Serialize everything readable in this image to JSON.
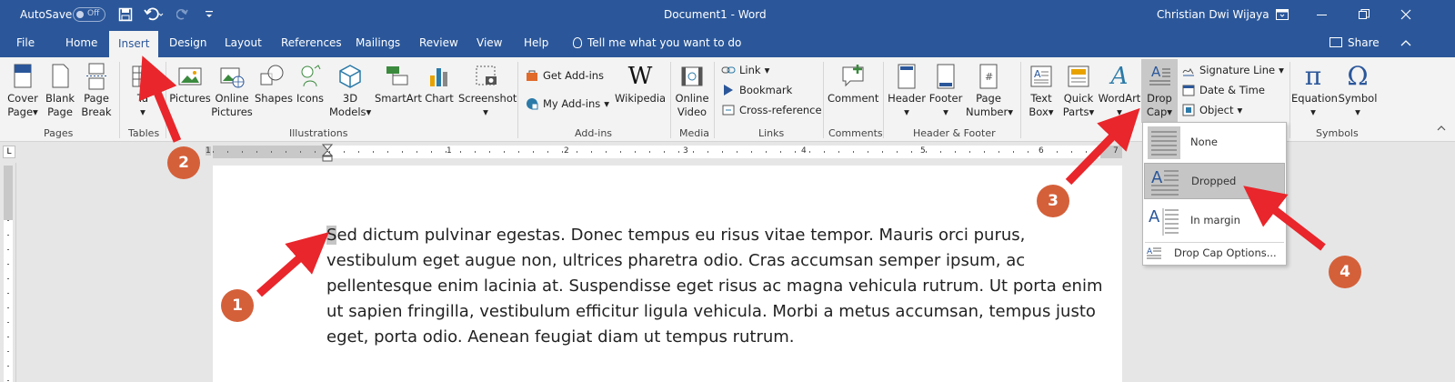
{
  "titlebar": {
    "autosave_label": "AutoSave",
    "autosave_state": "Off",
    "doc_title": "Document1  -  Word",
    "user_name": "Christian Dwi Wijaya"
  },
  "tabs": [
    {
      "label": "File"
    },
    {
      "label": "Home"
    },
    {
      "label": "Insert"
    },
    {
      "label": "Design"
    },
    {
      "label": "Layout"
    },
    {
      "label": "References"
    },
    {
      "label": "Mailings"
    },
    {
      "label": "Review"
    },
    {
      "label": "View"
    },
    {
      "label": "Help"
    }
  ],
  "tell_me": "Tell me what you want to do",
  "share": "Share",
  "ribbon": {
    "cover_page": [
      "Cover",
      "Page"
    ],
    "blank_page": [
      "Blank",
      "Page"
    ],
    "page_break": [
      "Page",
      "Break"
    ],
    "table": "Ta",
    "pictures": "Pictures",
    "online_pictures": [
      "Online",
      "Pictures"
    ],
    "shapes": "Shapes",
    "icons": "Icons",
    "models_3d": [
      "3D",
      "Models"
    ],
    "smartart": "SmartArt",
    "chart": "Chart",
    "screenshot": "Screenshot",
    "get_addins": "Get Add-ins",
    "my_addins": "My Add-ins",
    "wikipedia": "Wikipedia",
    "online_video": [
      "Online",
      "Video"
    ],
    "link": "Link",
    "bookmark": "Bookmark",
    "cross_reference": "Cross-reference",
    "comment": "Comment",
    "header": "Header",
    "footer": "Footer",
    "page_number": [
      "Page",
      "Number"
    ],
    "text_box": [
      "Text",
      "Box"
    ],
    "quick_parts": [
      "Quick",
      "Parts"
    ],
    "wordart": "WordArt",
    "drop_cap": [
      "Drop",
      "Cap"
    ],
    "signature_line": "Signature Line",
    "date_time": "Date & Time",
    "object": "Object",
    "equation": "Equation",
    "symbol": "Symbol",
    "groups": {
      "pages": "Pages",
      "tables": "Tables",
      "illustrations": "Illustrations",
      "addins": "Add-ins",
      "media": "Media",
      "links": "Links",
      "comments": "Comments",
      "header_footer": "Header & Footer",
      "symbols": "Symbols"
    }
  },
  "document": {
    "first_letter": "S",
    "paragraph_rest": "ed dictum pulvinar egestas. Donec tempus eu risus vitae tempor. Mauris orci purus, vestibulum eget augue non, ultrices pharetra odio. Cras accumsan semper ipsum, ac pellentesque enim lacinia at. Suspendisse eget risus ac magna vehicula rutrum. Ut porta enim ut sapien fringilla, vestibulum efficitur ligula vehicula. Morbi a metus accumsan, tempus justo eget, porta odio. Aenean feugiat diam ut tempus rutrum."
  },
  "drop_cap_menu": {
    "none": "None",
    "dropped": "Dropped",
    "in_margin": "In margin",
    "options": "Drop Cap Options..."
  },
  "ruler_numbers": [
    "1",
    "1",
    "2",
    "3",
    "4",
    "5",
    "6",
    "7"
  ],
  "callouts": [
    "1",
    "2",
    "3",
    "4"
  ],
  "colors": {
    "word_blue": "#2b579a",
    "callout": "#d4603a",
    "arrow": "#e8262b",
    "highlight": "#c5c5c5"
  }
}
